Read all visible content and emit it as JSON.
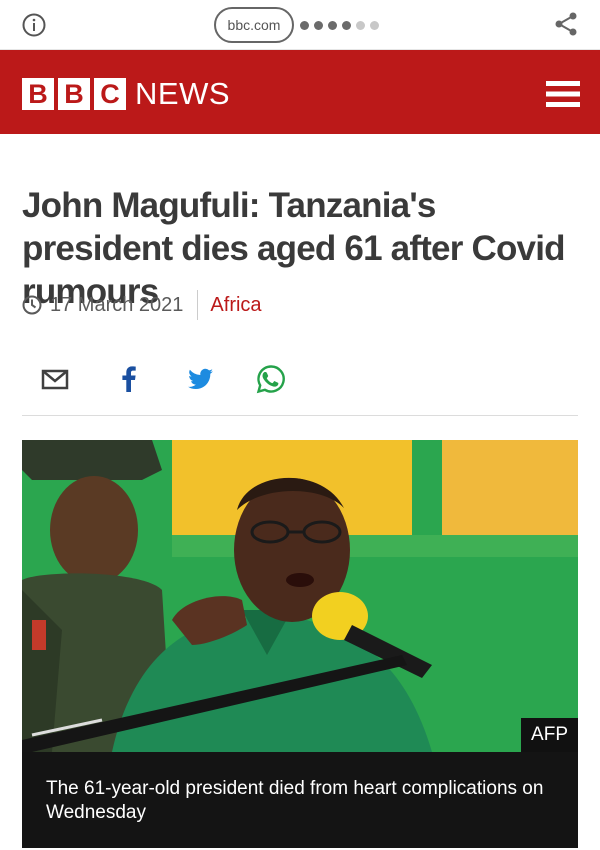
{
  "browser": {
    "url": "bbc.com",
    "icons": {
      "info": "info-icon",
      "share": "share-icon"
    }
  },
  "header": {
    "logo_letters": [
      "B",
      "B",
      "C"
    ],
    "section": "NEWS",
    "menu_icon": "hamburger-menu-icon",
    "bg_color": "#bb1919"
  },
  "article": {
    "headline": "John Magufuli: Tanzania's president dies aged 61 after Covid rumours",
    "date": "17 March 2021",
    "category": "Africa",
    "share_icons": [
      "email-icon",
      "facebook-icon",
      "twitter-icon",
      "whatsapp-icon"
    ],
    "image": {
      "credit": "AFP",
      "caption": "The 61-year-old president died from heart complications on Wednesday"
    }
  }
}
